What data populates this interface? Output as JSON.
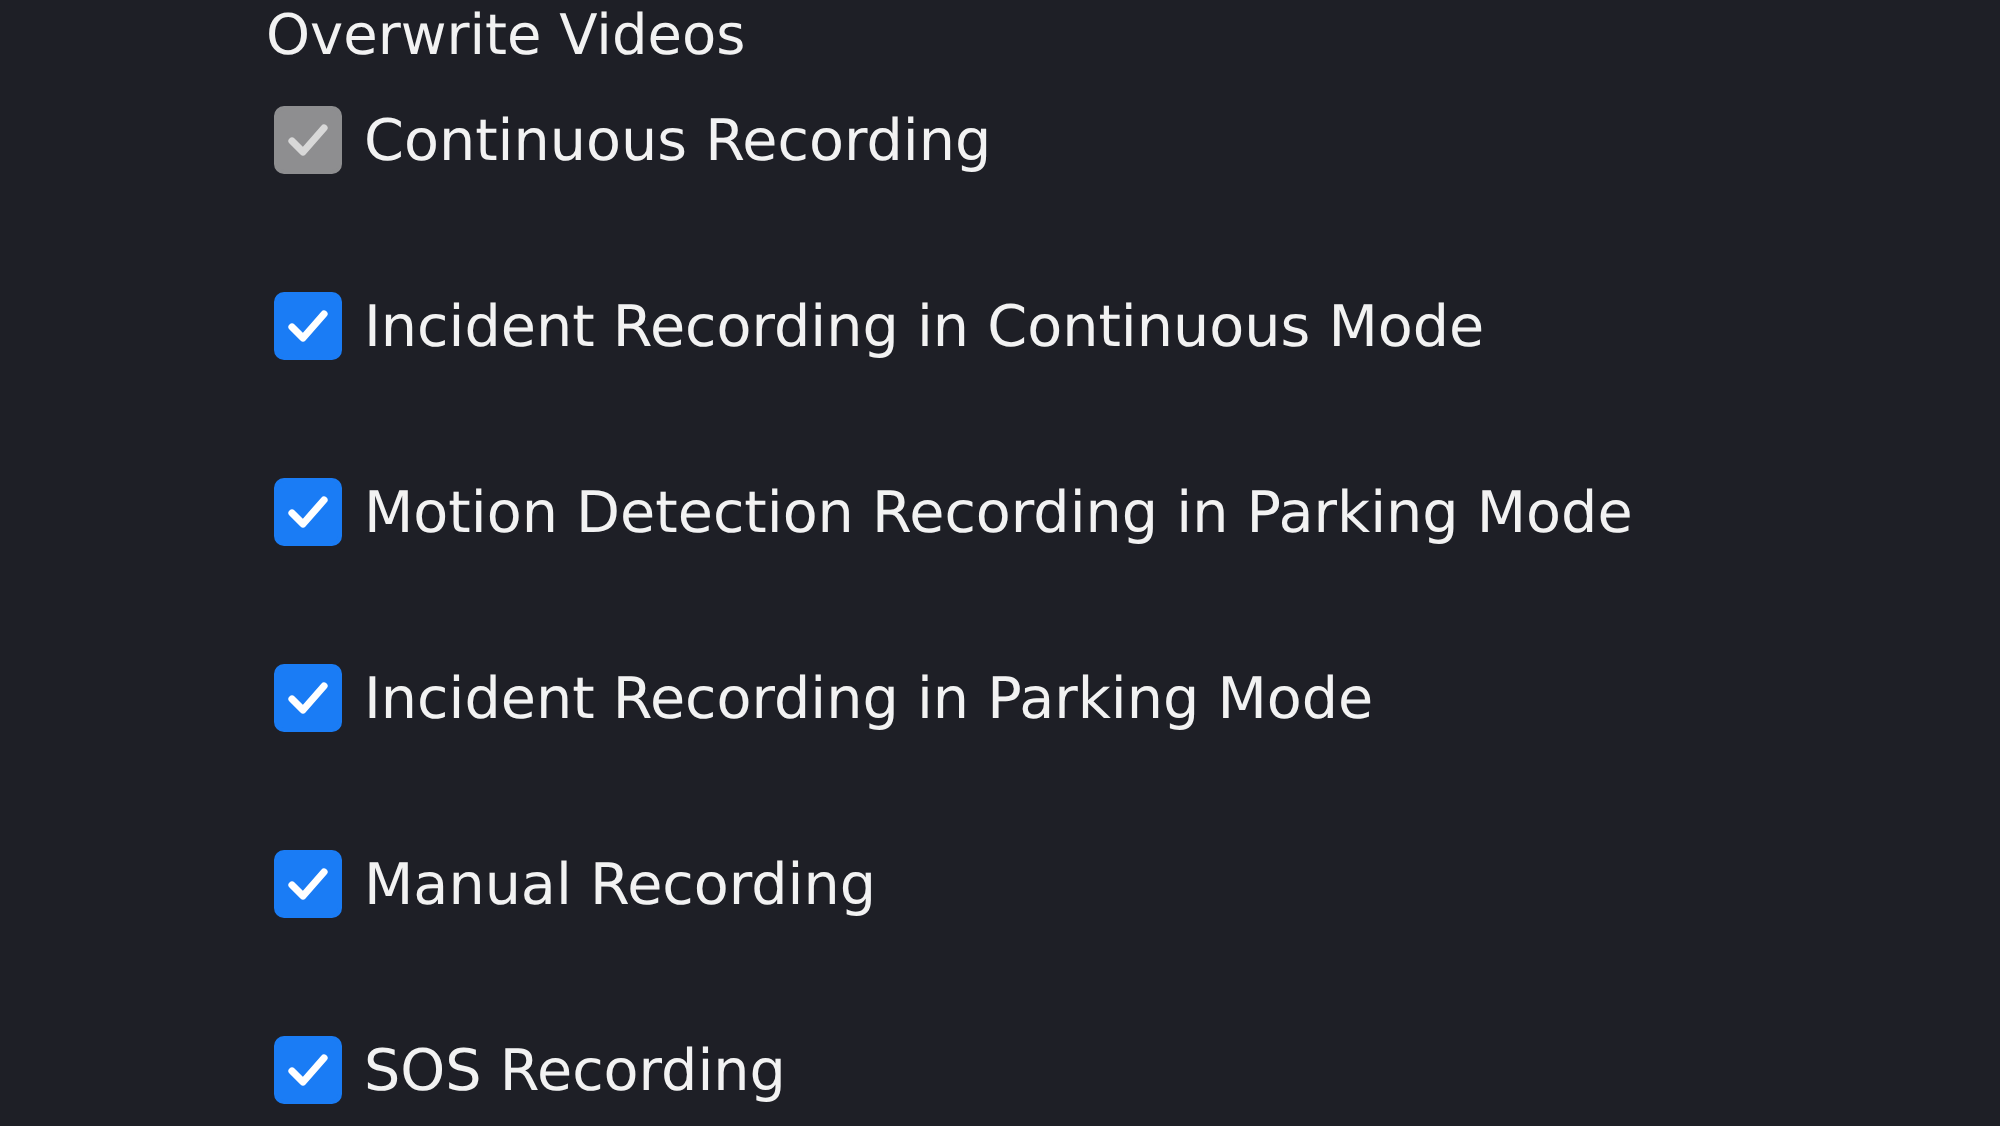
{
  "heading": "Overwrite Videos",
  "options": [
    {
      "label": "Continuous Recording",
      "checked": true,
      "disabled": true
    },
    {
      "label": "Incident Recording in Continuous Mode",
      "checked": true,
      "disabled": false
    },
    {
      "label": "Motion Detection Recording in Parking Mode",
      "checked": true,
      "disabled": false
    },
    {
      "label": "Incident Recording in Parking Mode",
      "checked": true,
      "disabled": false
    },
    {
      "label": "Manual Recording",
      "checked": true,
      "disabled": false
    },
    {
      "label": "SOS Recording",
      "checked": true,
      "disabled": false
    }
  ]
}
